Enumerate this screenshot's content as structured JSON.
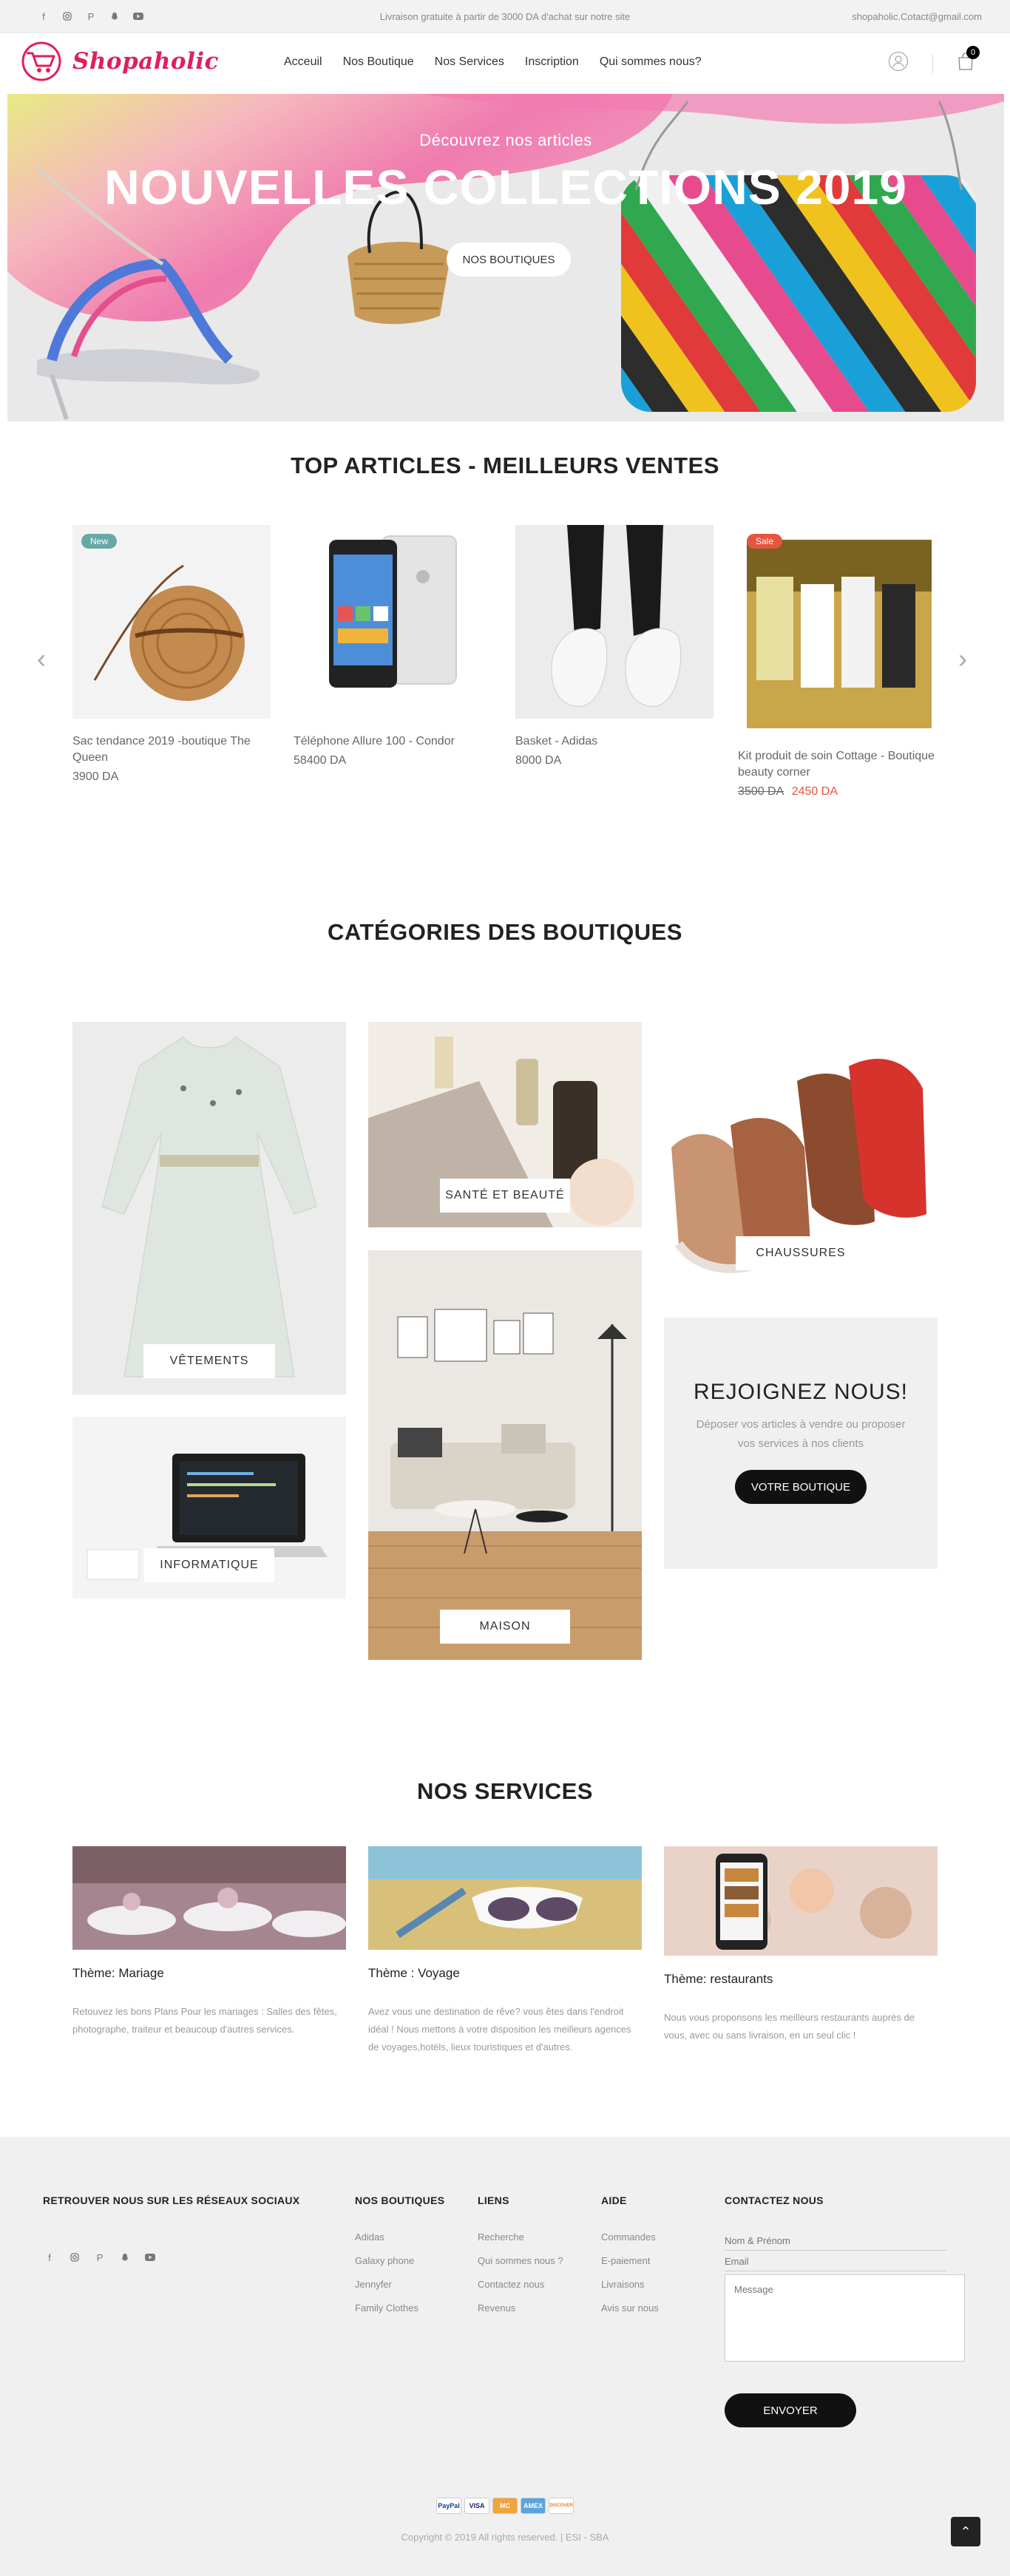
{
  "topbar": {
    "socials": [
      "facebook-icon",
      "instagram-icon",
      "pinterest-icon",
      "snapchat-icon",
      "youtube-icon"
    ],
    "promo": "Livraison gratuite à partir de 3000 DA d'achat sur notre site",
    "email": "shopaholic.Cotact@gmail.com"
  },
  "header": {
    "logo": "Shopaholic",
    "nav": [
      "Acceuil",
      "Nos Boutique",
      "Nos Services",
      "Inscription",
      "Qui sommes nous?"
    ],
    "cart_count": "0"
  },
  "hero": {
    "subtitle": "Découvrez nos articles",
    "title": "NOUVELLES COLLECTIONS 2019",
    "cta": "NOS BOUTIQUES"
  },
  "top_articles": {
    "title": "TOP ARTICLES - MEILLEURS VENTES",
    "items": [
      {
        "name": "Sac tendance 2019 -boutique The Queen",
        "price": "3900 DA",
        "tag": "New"
      },
      {
        "name": "Téléphone Allure 100 - Condor",
        "price": "58400 DA",
        "tag": ""
      },
      {
        "name": "Basket - Adidas",
        "price": "8000 DA",
        "tag": ""
      },
      {
        "name": "Kit produit de soin Cottage - Boutique beauty corner",
        "old_price": "3500 DA",
        "price": "2450 DA",
        "tag": "Sale"
      }
    ]
  },
  "categories": {
    "title": "CATÉGORIES DES BOUTIQUES",
    "items": [
      "VÊTEMENTS",
      "SANTÉ ET BEAUTÉ",
      "CHAUSSURES",
      "INFORMATIQUE",
      "MAISON"
    ],
    "join": {
      "title": "REJOIGNEZ NOUS!",
      "text": "Déposer vos articles à vendre ou proposer vos services à nos clients",
      "button": "VOTRE BOUTIQUE"
    }
  },
  "services": {
    "title": "NOS SERVICES",
    "items": [
      {
        "title": "Thème: Mariage",
        "text": "Retouvez les bons Plans Pour les mariages : Salles des fêtes, photographe, traiteur et beaucoup d'autres services."
      },
      {
        "title": "Thème : Voyage",
        "text": "Avez vous une destination de rêve? vous êtes dans l'endroit idéal ! Nous mettons à votre disposition les meilleurs agences de voyages,hotéls, lieux touristiques et d'autres."
      },
      {
        "title": "Thème: restaurants",
        "text": "Nous vous proponsons les meilleurs restaurants auprès de vous, avec ou sans livraison, en un seul clic !"
      }
    ]
  },
  "footer": {
    "social_title": "RETROUVER NOUS SUR LES RÉSEAUX SOCIAUX",
    "shops_title": "NOS BOUTIQUES",
    "shops": [
      "Adidas",
      "Galaxy phone",
      "Jennyfer",
      "Family Clothes"
    ],
    "links_title": "LIENS",
    "links": [
      "Recherche",
      "Qui sommes nous ?",
      "Contactez nous",
      "Revenus"
    ],
    "help_title": "AIDE",
    "help": [
      "Commandes",
      "E-paiement",
      "Livraisons",
      "Avis sur nous"
    ],
    "contact_title": "CONTACTEZ NOUS",
    "name_placeholder": "Nom & Prénom",
    "email_placeholder": "Email",
    "message_placeholder": "Message",
    "send": "ENVOYER",
    "payments": [
      "PayPal",
      "VISA",
      "MC",
      "AMEX",
      "DISCOVER"
    ],
    "copyright": "Copyright © 2019 All rights reserved. | ESI - SBA"
  }
}
